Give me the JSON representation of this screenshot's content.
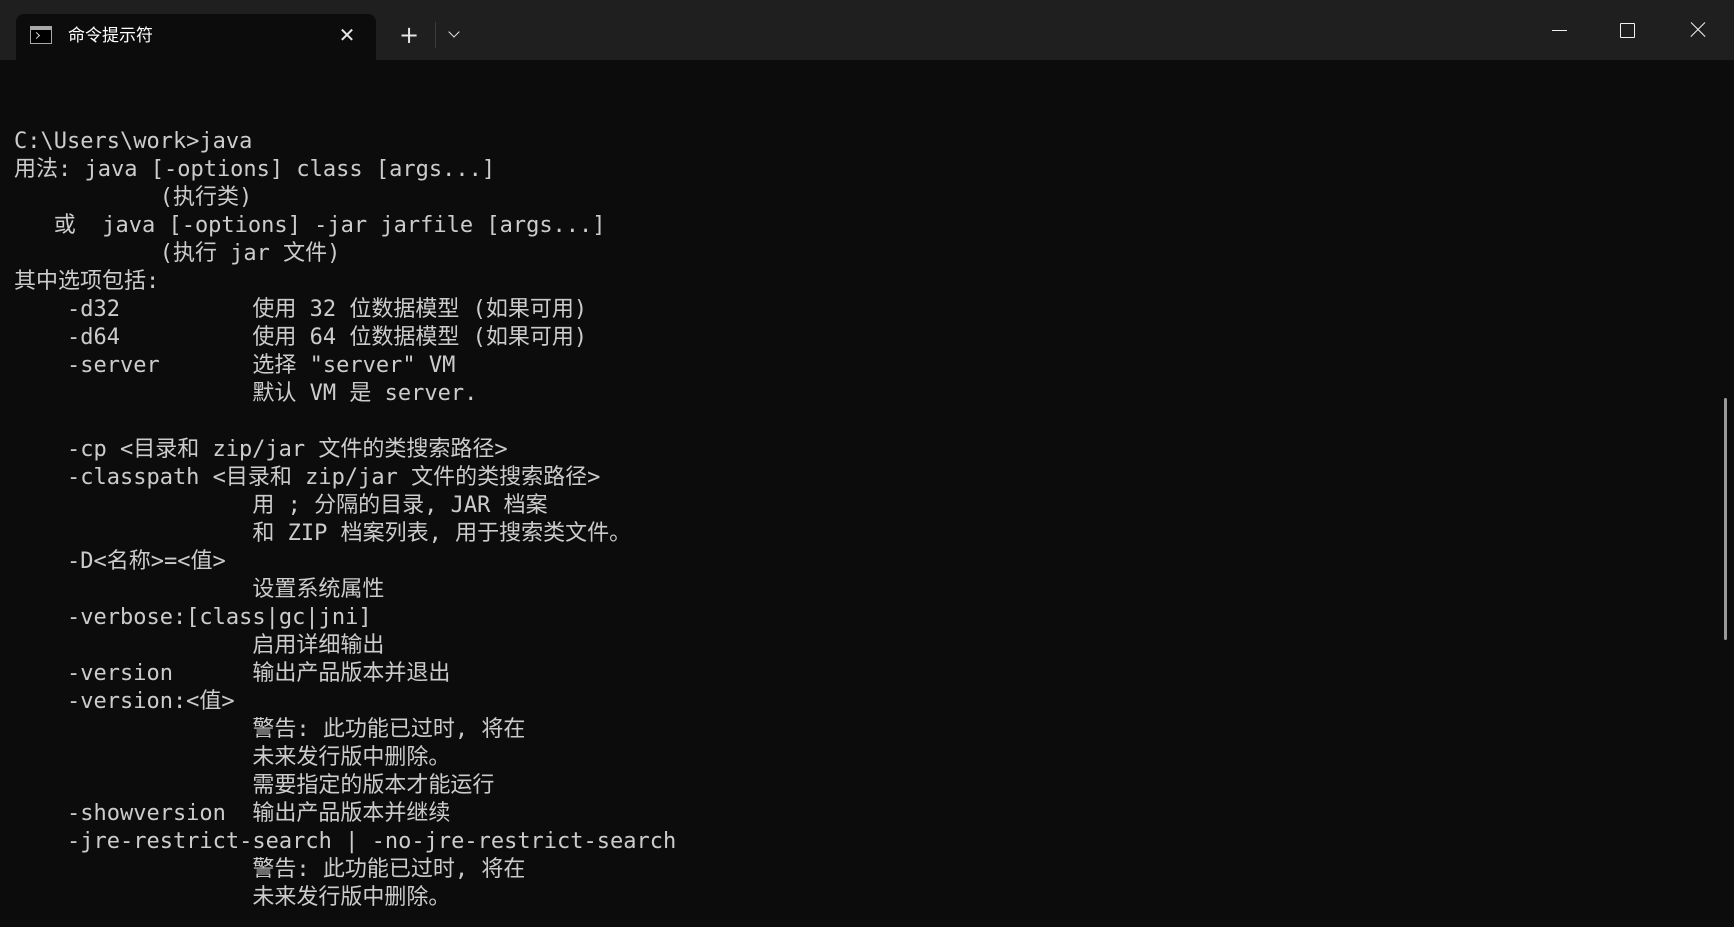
{
  "window": {
    "tab_title": "命令提示符",
    "tab_close_glyph": "✕",
    "new_tab_glyph": "+",
    "icons": {
      "tab": "terminal-icon",
      "dropdown": "chevron-down-icon",
      "minimize": "minimize-icon",
      "maximize": "maximize-icon",
      "close": "close-icon"
    }
  },
  "console": {
    "lines": [
      "C:\\Users\\work>java",
      "用法: java [-options] class [args...]",
      "           (执行类)",
      "   或  java [-options] -jar jarfile [args...]",
      "           (执行 jar 文件)",
      "其中选项包括:",
      "    -d32          使用 32 位数据模型 (如果可用)",
      "    -d64          使用 64 位数据模型 (如果可用)",
      "    -server       选择 \"server\" VM",
      "                  默认 VM 是 server.",
      "",
      "    -cp <目录和 zip/jar 文件的类搜索路径>",
      "    -classpath <目录和 zip/jar 文件的类搜索路径>",
      "                  用 ; 分隔的目录, JAR 档案",
      "                  和 ZIP 档案列表, 用于搜索类文件。",
      "    -D<名称>=<值>",
      "                  设置系统属性",
      "    -verbose:[class|gc|jni]",
      "                  启用详细输出",
      "    -version      输出产品版本并退出",
      "    -version:<值>",
      "                  警告: 此功能已过时, 将在",
      "                  未来发行版中删除。",
      "                  需要指定的版本才能运行",
      "    -showversion  输出产品版本并继续",
      "    -jre-restrict-search | -no-jre-restrict-search",
      "                  警告: 此功能已过时, 将在",
      "                  未来发行版中删除。"
    ]
  },
  "colors": {
    "background": "#0c0c0c",
    "titlebar": "#1f1f1f",
    "text": "#cccccc"
  }
}
